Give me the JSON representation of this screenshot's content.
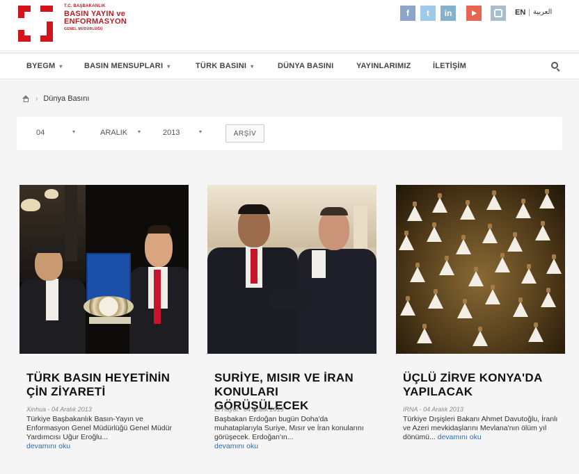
{
  "header": {
    "logo": {
      "line1": "T.C. BAŞBAKANLIK",
      "line2": "BASIN YAYIN ve",
      "line3": "ENFORMASYON",
      "line4": "GENEL MÜDÜRLÜĞÜ"
    },
    "social": [
      {
        "icon": "facebook-icon",
        "glyph": "f",
        "color": "#8ba6c9"
      },
      {
        "icon": "twitter-icon",
        "glyph": "t",
        "color": "#9ccbe8"
      },
      {
        "icon": "linkedin-icon",
        "glyph": "in",
        "color": "#86b1cc"
      },
      {
        "icon": "youtube-icon",
        "glyph": "",
        "color": "#e8664f"
      },
      {
        "icon": "instagram-icon",
        "glyph": "",
        "color": "#a8bdd0"
      }
    ],
    "lang_en": "EN",
    "lang_sep": "|",
    "lang_ar": "العربية"
  },
  "nav": {
    "items": [
      {
        "label": "BYEGM",
        "dropdown": true
      },
      {
        "label": "BASIN MENSUPLARI",
        "dropdown": true
      },
      {
        "label": "TÜRK BASINI",
        "dropdown": true
      },
      {
        "label": "DÜNYA BASINI",
        "dropdown": false
      },
      {
        "label": "YAYINLARIMIZ",
        "dropdown": false
      },
      {
        "label": "İLETİŞİM",
        "dropdown": false
      }
    ],
    "caret": "▾",
    "search_icon": "search-icon"
  },
  "breadcrumb": {
    "home_icon": "home-icon",
    "separator": "›",
    "current": "Dünya Basını"
  },
  "filter": {
    "day": "04",
    "month": "ARALIK",
    "year": "2013",
    "caret": "▾",
    "archive_label": "ARŞİV"
  },
  "articles": [
    {
      "title": "TÜRK BASIN HEYETİNİN ÇİN ZİYARETİ",
      "meta": "Xinhua - 04 Aralık 2013",
      "excerpt": "Türkiye Başbakanlık Basın-Yayın ve Enformasyon Genel Müdürlüğü Genel Müdür Yardımcısı Uğur Eroğlu...",
      "more": "devamını oku"
    },
    {
      "title": "SURİYE, MISIR VE İRAN KONULARI GÖRÜŞÜLECEK",
      "meta": "El Hayat - 04 Aralık 2013",
      "excerpt": "Başbakan Erdoğan bugün Doha'da muhataplarıyla Suriye, Mısır ve İran konularını görüşecek. Erdoğan'ın...",
      "more": "devamını oku"
    },
    {
      "title": "ÜÇLÜ ZİRVE KONYA'DA YAPILACAK",
      "meta": "IRNA - 04 Aralık 2013",
      "excerpt": "Türkiye Dışişleri Bakanı Ahmet Davutoğlu, İranlı ve Azeri mevkidaşlarını Mevlana'nın ölüm yıl dönümü...",
      "more": "devamını oku"
    }
  ],
  "colors": {
    "brand_red": "#d4141b",
    "link_blue": "#2b6cb0",
    "page_bg": "#f5f5f5"
  }
}
